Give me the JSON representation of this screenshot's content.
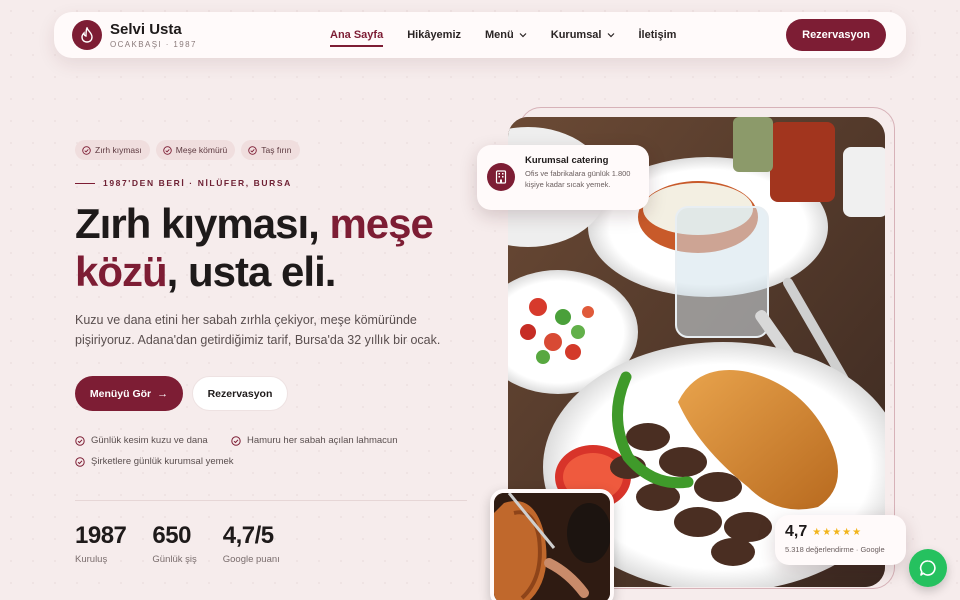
{
  "brand": {
    "name": "Selvi Usta",
    "sub": "OCAKBAŞI · 1987",
    "logo_icon": "flame-icon"
  },
  "nav": {
    "items": [
      {
        "label": "Ana Sayfa",
        "active": true,
        "dropdown": false
      },
      {
        "label": "Hikâyemiz",
        "active": false,
        "dropdown": false
      },
      {
        "label": "Menü",
        "active": false,
        "dropdown": true
      },
      {
        "label": "Kurumsal",
        "active": false,
        "dropdown": true
      },
      {
        "label": "İletişim",
        "active": false,
        "dropdown": false
      }
    ],
    "cta": "Rezervasyon"
  },
  "hero": {
    "tags": [
      "Zırh kıyması",
      "Meşe kömürü",
      "Taş fırın"
    ],
    "eyebrow": "1987'DEN BERİ · NİLÜFER, BURSA",
    "headline_part1": "Zırh kıyması, ",
    "headline_accent1": "meşe",
    "headline_accent2": "közü",
    "headline_part2": ", usta eli.",
    "lead": "Kuzu ve dana etini her sabah zırhla çekiyor, meşe kömüründe pişiriyoruz. Adana'dan getirdiğimiz tarif, Bursa'da 32 yıllık bir ocak.",
    "primary_button": "Menüyü Gör",
    "secondary_button": "Rezervasyon",
    "checks": [
      "Günlük kesim kuzu ve dana",
      "Hamuru her sabah açılan lahmacun",
      "Şirketlere günlük kurumsal yemek"
    ],
    "stats": [
      {
        "value": "1987",
        "label": "Kuruluş"
      },
      {
        "value": "650",
        "label": "Günlük şiş"
      },
      {
        "value": "4,7/5",
        "label": "Google puanı"
      }
    ]
  },
  "catering_card": {
    "icon": "building-icon",
    "title": "Kurumsal catering",
    "desc": "Ofis ve fabrikalara günlük 1.800 kişiye kadar sıcak yemek."
  },
  "rating_card": {
    "value": "4,7",
    "stars": 5,
    "sub": "5.318 değerlendirme · Google"
  },
  "colors": {
    "accent": "#7d1d34",
    "background": "#f6ecec",
    "star": "#f2b51c",
    "whatsapp": "#25c15f"
  },
  "whatsapp_icon": "chat-bubble-icon"
}
